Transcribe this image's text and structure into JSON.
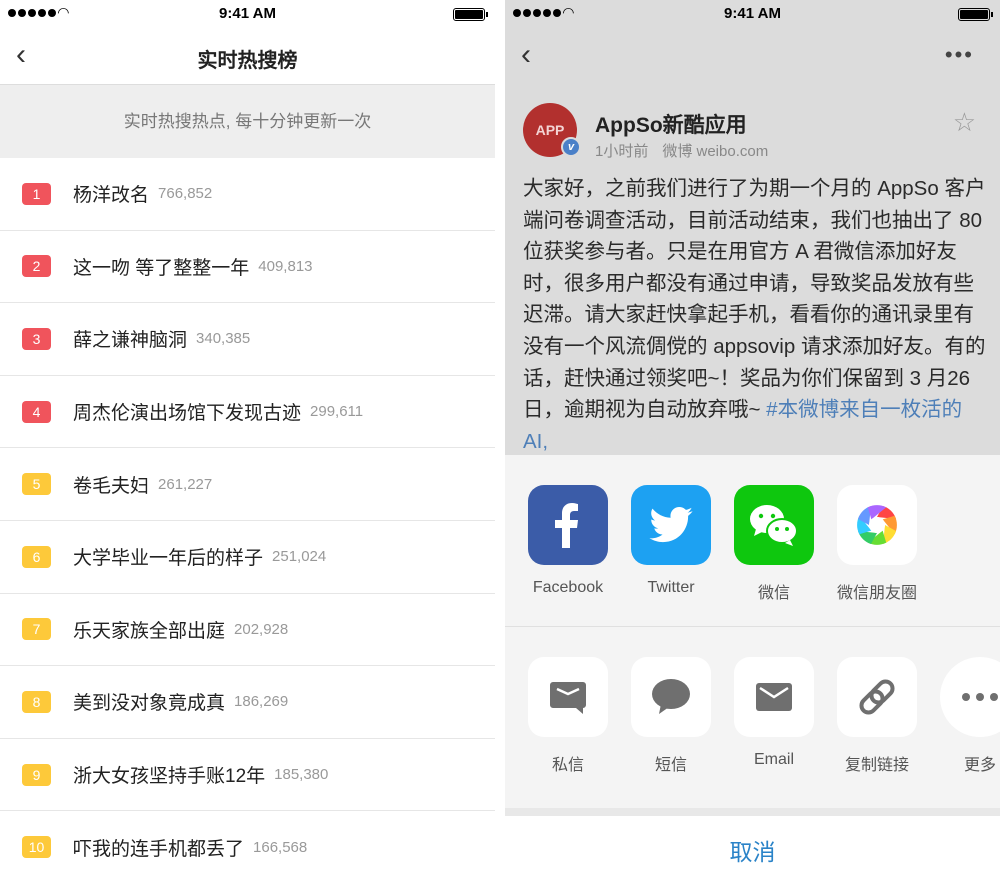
{
  "status_bar": {
    "time": "9:41 AM"
  },
  "left": {
    "nav": {
      "title": "实时热搜榜"
    },
    "banner": "实时热搜热点, 每十分钟更新一次",
    "items": [
      {
        "rank": "1",
        "title": "杨洋改名",
        "count": "766,852",
        "color": "#f0545c"
      },
      {
        "rank": "2",
        "title": "这一吻 等了整整一年",
        "count": "409,813",
        "color": "#f0545c"
      },
      {
        "rank": "3",
        "title": "薛之谦神脑洞",
        "count": "340,385",
        "color": "#f0545c"
      },
      {
        "rank": "4",
        "title": "周杰伦演出场馆下发现古迹",
        "count": "299,611",
        "color": "#f0545c"
      },
      {
        "rank": "5",
        "title": "卷毛夫妇",
        "count": "261,227",
        "color": "#fdc93a"
      },
      {
        "rank": "6",
        "title": "大学毕业一年后的样子",
        "count": "251,024",
        "color": "#fdc93a"
      },
      {
        "rank": "7",
        "title": "乐天家族全部出庭",
        "count": "202,928",
        "color": "#fdc93a"
      },
      {
        "rank": "8",
        "title": "美到没对象竟成真",
        "count": "186,269",
        "color": "#fdc93a"
      },
      {
        "rank": "9",
        "title": "浙大女孩坚持手账12年",
        "count": "185,380",
        "color": "#fdc93a"
      },
      {
        "rank": "10",
        "title": "吓我的连手机都丢了",
        "count": "166,568",
        "color": "#fdc93a"
      }
    ]
  },
  "right": {
    "post": {
      "avatar_text": "APP",
      "author": "AppSo新酷应用",
      "time": "1小时前",
      "source": "微博 weibo.com",
      "body": "大家好，之前我们进行了为期一个月的 AppSo 客户端问卷调查活动，目前活动结束，我们也抽出了 80 位获奖参与者。只是在用官方 A 君微信添加好友时，很多用户都没有通过申请，导致奖品发放有些迟滞。请大家赶快拿起手机，看看你的通讯录里有没有一个风流倜傥的 appsovip 请求添加好友。有的话，赶快通过领奖吧~！奖品为你们保留到 3 月26 日，逾期视为自动放弃哦~ ",
      "hashtag": "#本微博来自一枚活的 AI,"
    },
    "share_row1": [
      {
        "label": "Facebook",
        "icon": "facebook-icon",
        "color": "#3b5ca8"
      },
      {
        "label": "Twitter",
        "icon": "twitter-icon",
        "color": "#1da1f2"
      },
      {
        "label": "微信",
        "icon": "wechat-icon",
        "color": "#0ec70e"
      },
      {
        "label": "微信朋友圈",
        "icon": "moments-icon",
        "color": "#ffffff"
      }
    ],
    "share_row2": [
      {
        "label": "私信",
        "icon": "direct-message-icon"
      },
      {
        "label": "短信",
        "icon": "sms-icon"
      },
      {
        "label": "Email",
        "icon": "email-icon"
      },
      {
        "label": "复制链接",
        "icon": "link-icon"
      },
      {
        "label": "更多",
        "icon": "more-icon"
      }
    ],
    "cancel": "取消"
  }
}
